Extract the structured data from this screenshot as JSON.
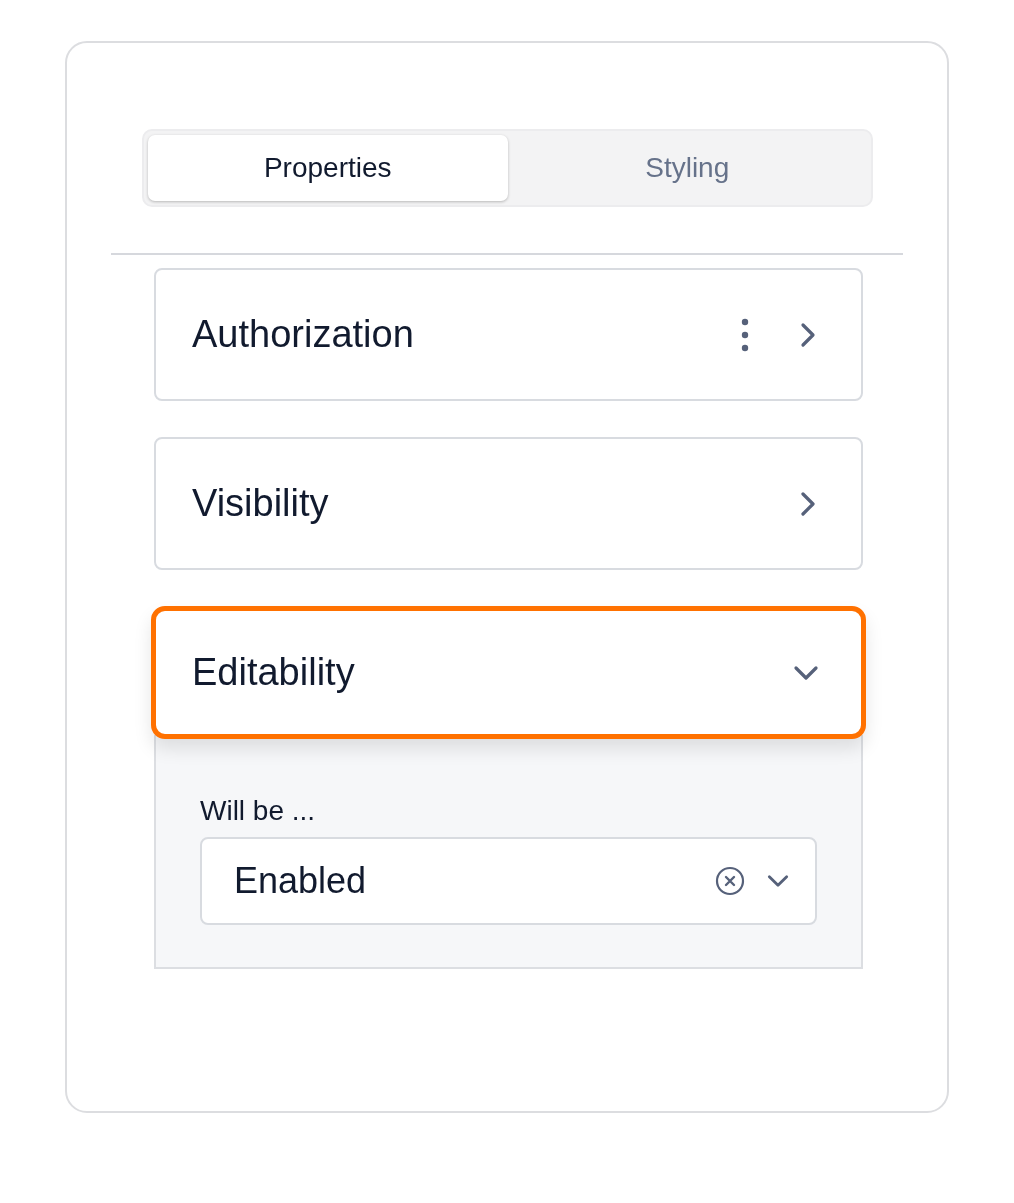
{
  "tabs": [
    {
      "label": "Properties",
      "selected": true
    },
    {
      "label": "Styling",
      "selected": false
    }
  ],
  "sections": [
    {
      "title": "Authorization",
      "menu": true,
      "expanded": false,
      "highlighted": false
    },
    {
      "title": "Visibility",
      "menu": false,
      "expanded": false,
      "highlighted": false
    },
    {
      "title": "Editability",
      "menu": false,
      "expanded": true,
      "highlighted": true,
      "field": {
        "label": "Will be ...",
        "value": "Enabled"
      }
    }
  ]
}
